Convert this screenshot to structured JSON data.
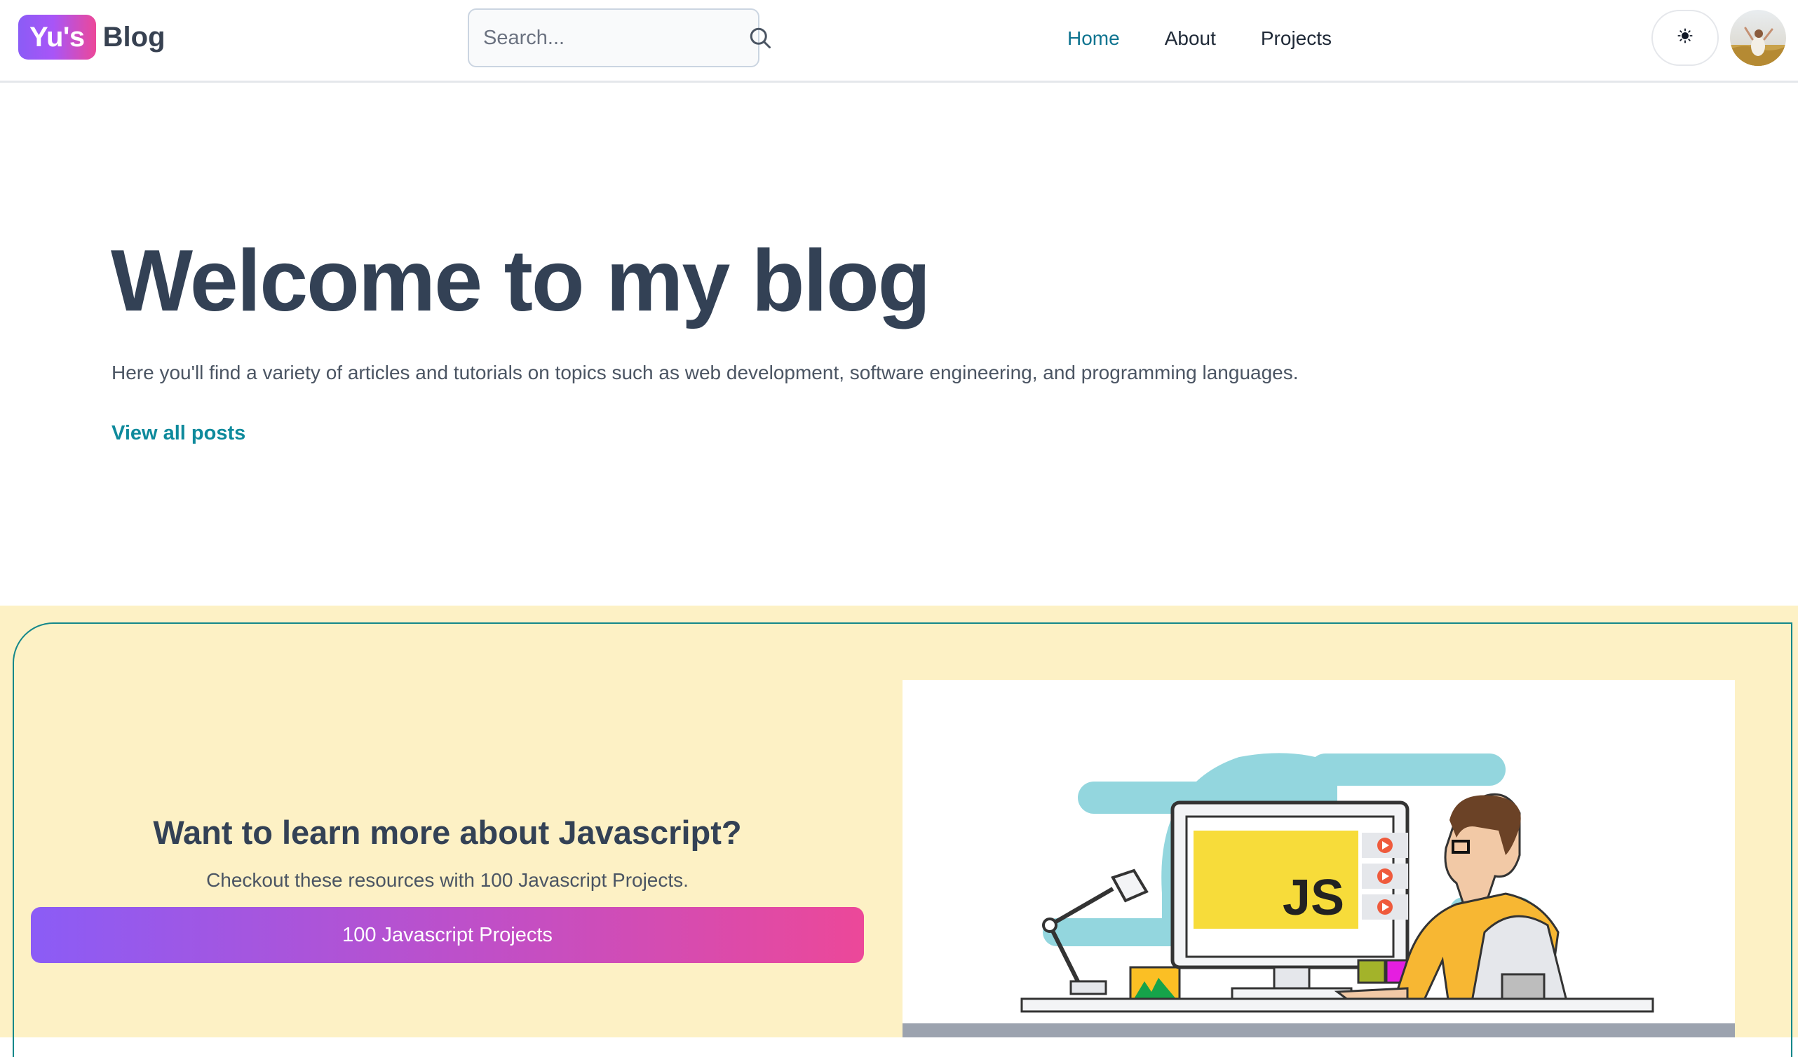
{
  "header": {
    "brand_badge": "Yu's",
    "brand_name": "Blog",
    "search_placeholder": "Search...",
    "nav": [
      {
        "label": "Home",
        "active": true
      },
      {
        "label": "About",
        "active": false
      },
      {
        "label": "Projects",
        "active": false
      }
    ],
    "theme_toggle_icon": "sun-icon",
    "avatar_icon": "user-avatar"
  },
  "hero": {
    "title": "Welcome to my blog",
    "description": "Here you'll find a variety of articles and tutorials on topics such as web development, software engineering, and programming languages.",
    "link_label": "View all posts"
  },
  "promo": {
    "title": "Want to learn more about Javascript?",
    "subtitle": "Checkout these resources with 100 Javascript Projects.",
    "button_label": "100 Javascript Projects",
    "illustration_text": "JS"
  },
  "colors": {
    "accent": "#0e8a9c",
    "promo_bg": "#fdf1c5",
    "gradient_start": "#8b5cf6",
    "gradient_end": "#ec4899"
  }
}
